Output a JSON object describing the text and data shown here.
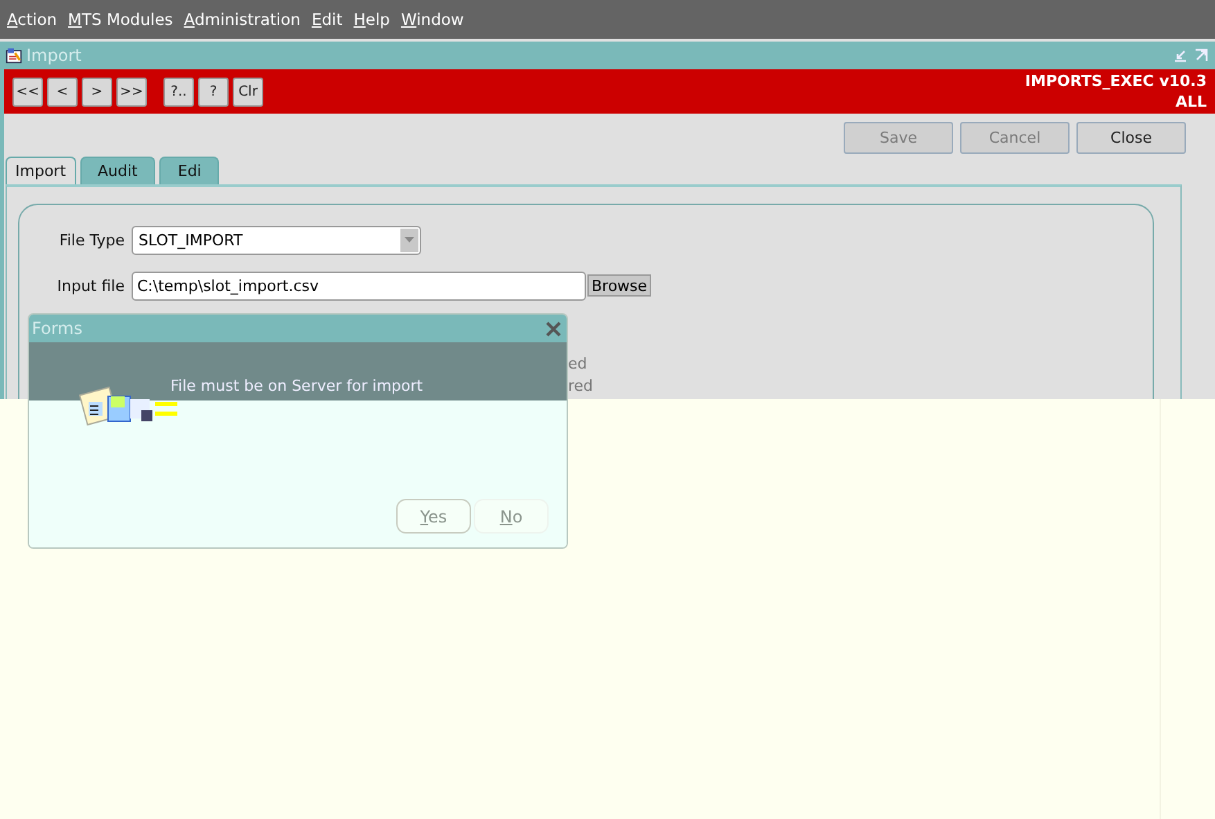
{
  "menu": [
    {
      "label": "Action"
    },
    {
      "label": "MTS Modules"
    },
    {
      "label": "Administration"
    },
    {
      "label": "Edit"
    },
    {
      "label": "Help"
    },
    {
      "label": "Window"
    }
  ],
  "window": {
    "title": "Import",
    "module": "IMPORTS_EXEC v10.3",
    "scope": "ALL"
  },
  "toolbar": [
    "<<",
    "<",
    ">",
    ">>",
    "?..",
    "?",
    "Clr"
  ],
  "actions": [
    {
      "label": "Save",
      "disabled": true
    },
    {
      "label": "Cancel",
      "disabled": true
    },
    {
      "label": "Close",
      "disabled": false
    }
  ],
  "tabs": [
    {
      "label": "Import",
      "selected": true
    },
    {
      "label": "Audit",
      "selected": false
    },
    {
      "label": "Edi",
      "selected": false
    }
  ],
  "form": {
    "file_type": {
      "label": "File Type",
      "value": "SLOT_IMPORT"
    },
    "input_file": {
      "label": "Input file",
      "value": "C:\\temp\\slot_import.csv",
      "button": "Browse"
    },
    "partial_labels": [
      "ed",
      "red"
    ]
  },
  "dialog": {
    "title": "Forms",
    "message": "File must be on Server for import",
    "buttons": [
      {
        "label": "Yes",
        "selected": true
      },
      {
        "label": "No",
        "selected": false
      }
    ]
  }
}
